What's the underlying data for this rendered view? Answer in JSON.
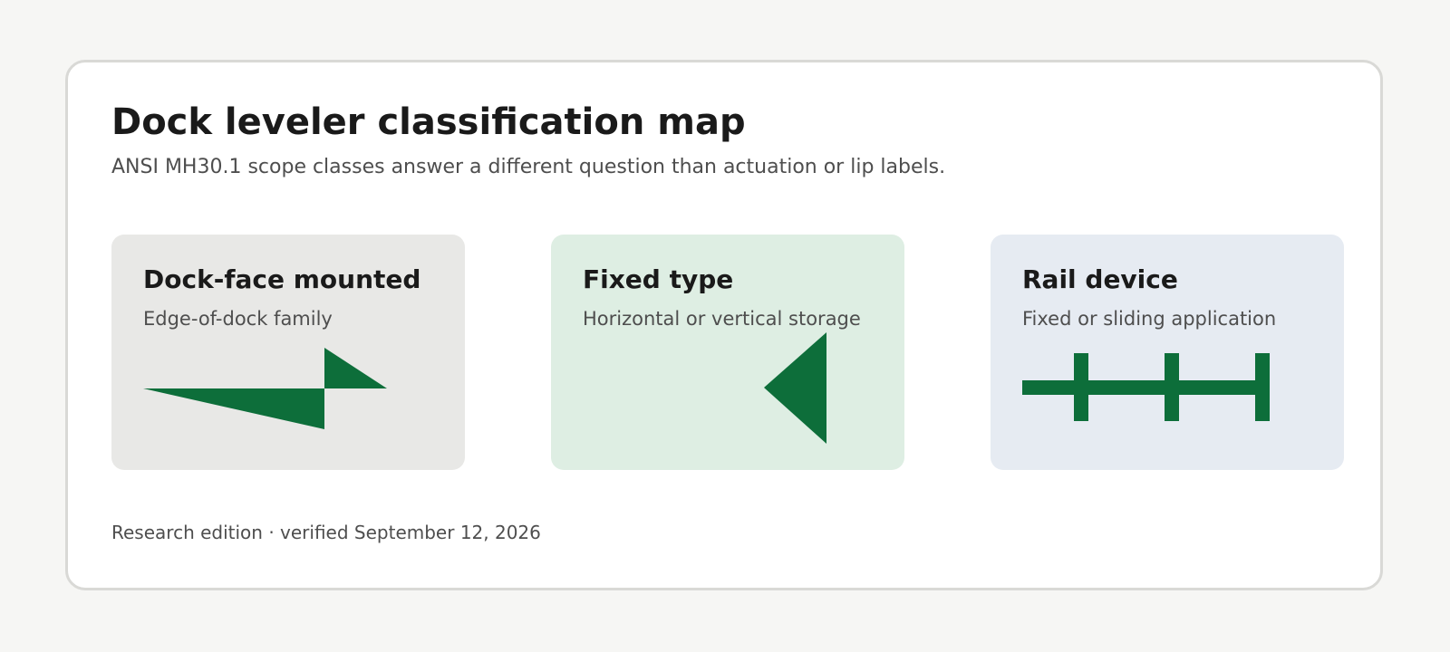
{
  "header": {
    "title": "Dock leveler classification map",
    "subtitle": "ANSI MH30.1 scope classes answer a different question than actuation or lip labels."
  },
  "cards": [
    {
      "title": "Dock-face mounted",
      "subtitle": "Edge-of-dock family",
      "background": "#e8e8e6",
      "icon": "dock-face-wedge-icon"
    },
    {
      "title": "Fixed type",
      "subtitle": "Horizontal or vertical storage",
      "background": "#deeee3",
      "icon": "fixed-type-triangle-icon"
    },
    {
      "title": "Rail device",
      "subtitle": "Fixed or sliding application",
      "background": "#e6ebf2",
      "icon": "rail-device-track-icon"
    }
  ],
  "footer": {
    "text": "Research edition · verified September 12, 2026"
  },
  "colors": {
    "accent": "#0d6e3a",
    "page_background": "#f6f6f4",
    "panel_border": "#d9d9d6"
  }
}
